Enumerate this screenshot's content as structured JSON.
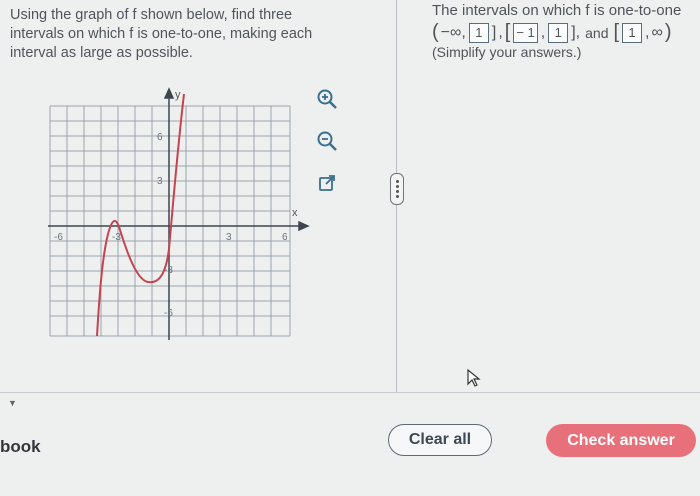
{
  "question": {
    "line1": "Using the graph of f shown below, find three",
    "line2": "intervals on which f is one-to-one, making each",
    "line3": "interval as large as possible."
  },
  "graph": {
    "axis_x_label": "x",
    "axis_y_label": "y",
    "x_ticks": [
      "-6",
      "-3",
      "3",
      "6"
    ],
    "y_ticks": [
      "6",
      "3",
      "-3",
      "-6"
    ]
  },
  "tools": {
    "zoom_in_icon": "zoom-in-icon",
    "zoom_out_icon": "zoom-out-icon",
    "popout_icon": "external-link-icon"
  },
  "answer": {
    "intro": "The intervals on which f is one-to-one",
    "open_neg_inf": "(",
    "neg_inf": "−∞,",
    "box1": "1",
    "box2a": "− 1",
    "box2b": "1",
    "and": "and",
    "box3": "1",
    "pos_inf": "∞",
    "close_paren": ")",
    "hint": "(Simplify your answers.)"
  },
  "footer": {
    "book_label": "book",
    "clear_all": "Clear all",
    "check_answer": "Check answer"
  },
  "colors": {
    "curve": "#c6434f",
    "grid": "#8d96a0",
    "check_bg": "#e8707a"
  }
}
